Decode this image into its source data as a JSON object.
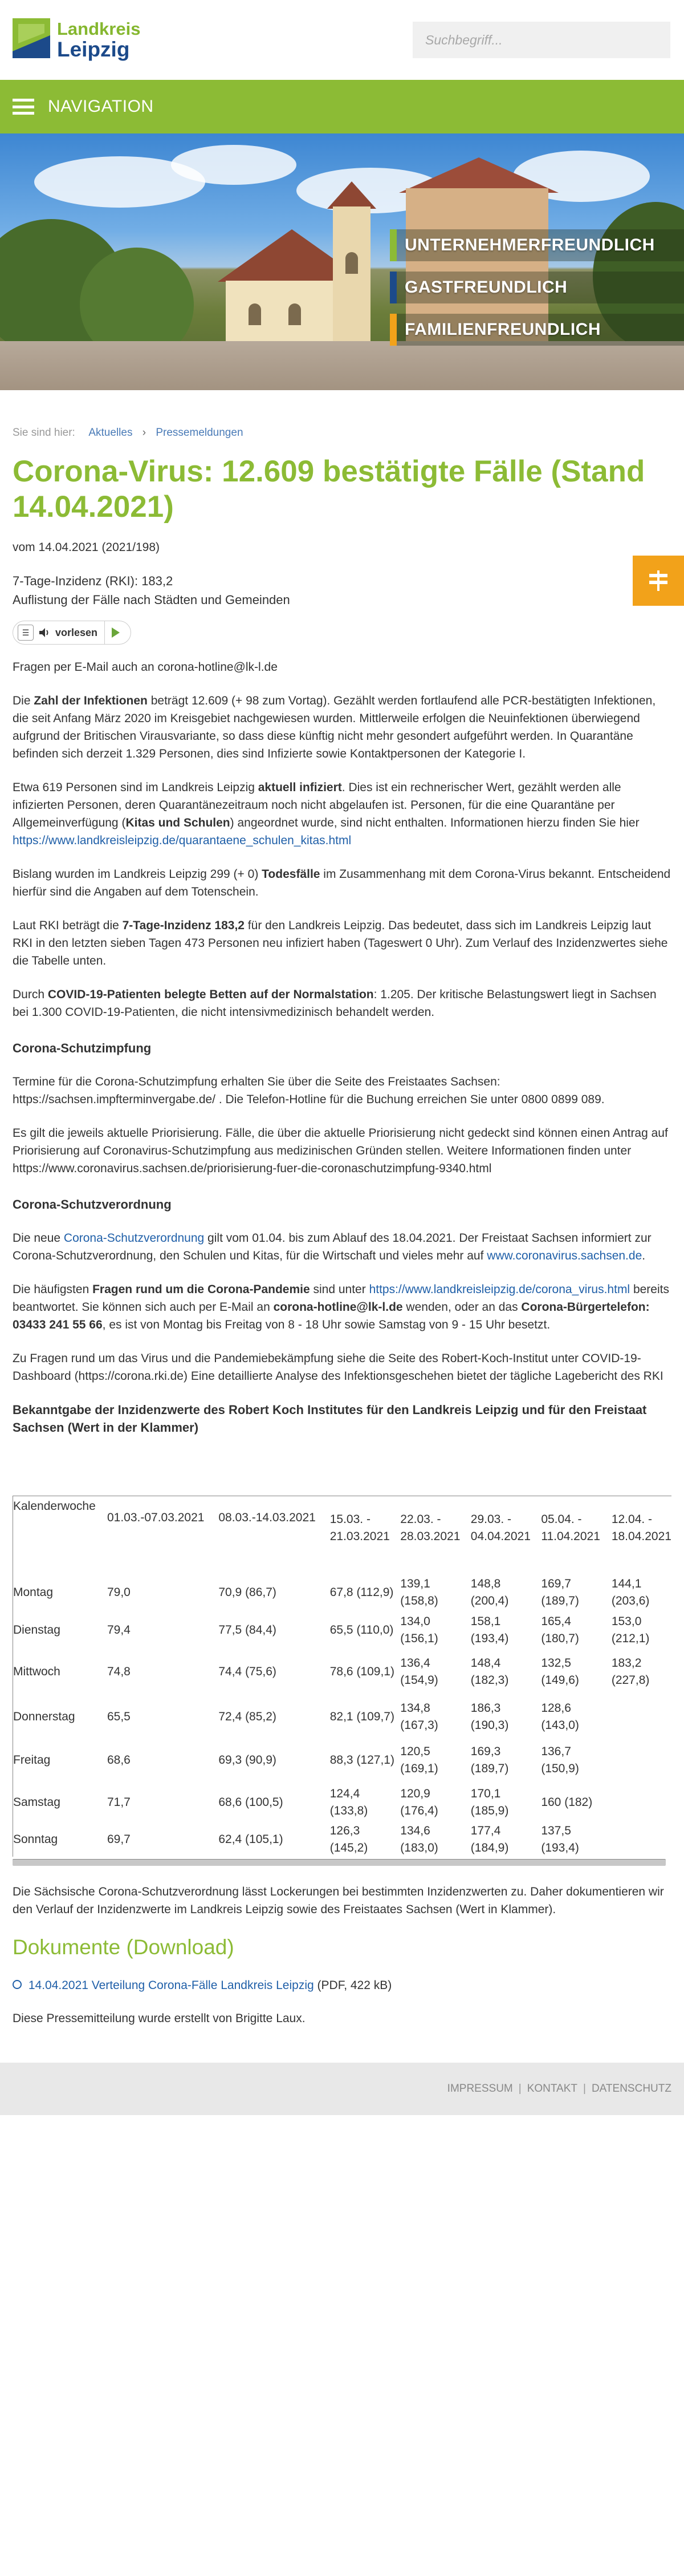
{
  "header": {
    "logo_line1": "Landkreis",
    "logo_line2": "Leipzig",
    "search_placeholder": "Suchbegriff..."
  },
  "nav": {
    "label": "NAVIGATION"
  },
  "hero": {
    "slogans": [
      {
        "text": "UNTERNEHMERFREUNDLICH",
        "color": "#8cbb35"
      },
      {
        "text": "GASTFREUNDLICH",
        "color": "#1c4a8a"
      },
      {
        "text": "FAMILIENFREUNDLICH",
        "color": "#f2a21a"
      }
    ]
  },
  "breadcrumb": {
    "prefix": "Sie sind hier:",
    "items": [
      "Aktuelles",
      "Pressemeldungen"
    ]
  },
  "article": {
    "title": "Corona-Virus: 12.609 bestätigte Fälle (Stand 14.04.2021)",
    "date": "vom 14.04.2021 (2021/198)",
    "lead1": "7-Tage-Inzidenz (RKI): 183,2",
    "lead2": "Auflistung der Fälle nach Städten und Gemeinden",
    "reader_label": "vorlesen",
    "email_line": "Fragen per E-Mail auch an corona-hotline@lk-l.de",
    "p1a": "Die ",
    "p1b": "Zahl der Infektionen",
    "p1c": " beträgt 12.609 (+ 98 zum Vortag). Gezählt werden fortlaufend alle PCR-bestätigten Infektionen, die seit Anfang März 2020 im Kreisgebiet nachgewiesen wurden. Mittlerweile erfolgen die Neuinfektionen überwiegend aufgrund der Britischen Virausvariante, so dass diese künftig nicht mehr gesondert aufgeführt werden. In Quarantäne befinden sich derzeit 1.329 Personen, dies sind Infizierte sowie Kontaktpersonen der Kategorie I.",
    "p2a": "Etwa 619 Personen sind im Landkreis Leipzig ",
    "p2b": "aktuell infiziert",
    "p2c": ". Dies ist ein rechnerischer Wert, gezählt werden alle infizierten Personen, deren Quarantänezeitraum noch nicht abgelaufen ist. Personen, für die eine Quarantäne per Allgemeinverfügung (",
    "p2d": "Kitas und Schulen",
    "p2e": ") angeordnet wurde, sind nicht enthalten. Informationen hierzu finden Sie hier ",
    "p2link": "https://www.landkreisleipzig.de/quarantaene_schulen_kitas.html",
    "p3a": "Bislang wurden im Landkreis Leipzig 299 (+ 0) ",
    "p3b": "Todesfälle",
    "p3c": " im Zusammenhang mit dem Corona-Virus bekannt. Entscheidend hierfür sind die Angaben auf dem Totenschein.",
    "p4a": "Laut RKI beträgt die ",
    "p4b": "7-Tage-Inzidenz 183,2",
    "p4c": " für den Landkreis Leipzig. Das bedeutet, dass sich im Landkreis Leipzig laut RKI in den letzten sieben Tagen 473 Personen neu infiziert haben (Tageswert 0 Uhr). Zum Verlauf des Inzidenzwertes siehe die Tabelle unten.",
    "p5a": "Durch ",
    "p5b": "COVID-19-Patienten belegte Betten auf der Normalstation",
    "p5c": ": 1.205. Der kritische Belastungswert liegt in Sachsen bei 1.300 COVID-19-Patienten, die nicht intensivmedizinisch behandelt werden.",
    "h_impf": "Corona-Schutzimpfung",
    "p6": "Termine für die Corona-Schutzimpfung erhalten Sie über die Seite des Freistaates Sachsen: https://sachsen.impfterminvergabe.de/ . Die Telefon-Hotline für die Buchung erreichen Sie unter 0800 0899 089.",
    "p7": "Es gilt die jeweils aktuelle Priorisierung. Fälle, die über die aktuelle Priorisierung nicht gedeckt sind können einen Antrag auf Priorisierung auf Coronavirus-Schutzimpfung aus medizinischen Gründen stellen. Weitere Informationen finden unter https://www.coronavirus.sachsen.de/priorisierung-fuer-die-coronaschutzimpfung-9340.html",
    "h_vo": "Corona-Schutzverordnung",
    "p8a": "Die neue ",
    "p8link": "Corona-Schutzverordnung",
    "p8b": " gilt vom 01.04. bis zum Ablauf des 18.04.2021. Der Freistaat Sachsen informiert zur Corona-Schutzverordnung, den Schulen und Kitas, für die Wirtschaft und vieles mehr auf ",
    "p8link2": "www.coronavirus.sachsen.de",
    "p8c": ".",
    "p9a": "Die häufigsten ",
    "p9b": "Fragen rund um die Corona-Pandemie",
    "p9c": " sind unter ",
    "p9link": "https://www.landkreisleipzig.de/corona_virus.html",
    "p9d": " bereits beantwortet. Sie können sich auch per E-Mail an ",
    "p9e": "corona-hotline@lk-l.de",
    "p9f": " wenden, oder an das ",
    "p9g": "Corona-Bürgertelefon: 03433 241 55 66",
    "p9h": ", es ist von Montag bis Freitag von 8 - 18 Uhr sowie Samstag von 9 - 15 Uhr besetzt.",
    "p10": "Zu Fragen rund um das Virus und die Pandemiebekämpfung siehe die Seite des Robert-Koch-Institut unter COVID-19-Dashboard (https://corona.rki.de)  Eine detaillierte Analyse des Infektionsgeschehen bietet der tägliche Lagebericht des RKI",
    "h_table": "Bekanntgabe der Inzidenzwerte des Robert Koch Institutes für den Landkreis Leipzig und für den Freistaat Sachsen (Wert in der Klammer)",
    "after_table": "Die Sächsische Corona-Schutzverordnung lässt Lockerungen bei bestimmten Inzidenzwerten zu. Daher dokumentieren wir den Verlauf der Inzidenzwerte im Landkreis Leipzig sowie des Freistaates Sachsen (Wert in Klammer).",
    "docs_heading": "Dokumente (Download)",
    "doc_link": "14.04.2021 Verteilung Corona-Fälle Landkreis Leipzig",
    "doc_meta": " (PDF, 422 kB)",
    "author": "Diese Pressemitteilung wurde erstellt von Brigitte Laux."
  },
  "table": {
    "headers": [
      "Kalenderwoche",
      "01.03.-07.03.2021",
      "08.03.-14.03.2021",
      "15.03. - 21.03.2021",
      "22.03. - 28.03.2021",
      "29.03. - 04.04.2021",
      "05.04. - 11.04.2021",
      "12.04. - 18.04.2021"
    ],
    "rows": [
      [
        "Montag",
        "79,0",
        "70,9 (86,7)",
        "67,8 (112,9)",
        "139,1 (158,8)",
        "148,8 (200,4)",
        "169,7 (189,7)",
        "144,1 (203,6)"
      ],
      [
        "Dienstag",
        "79,4",
        "77,5 (84,4)",
        "65,5 (110,0)",
        "134,0 (156,1)",
        "158,1 (193,4)",
        "165,4 (180,7)",
        "153,0 (212,1)"
      ],
      [
        "Mittwoch",
        "74,8",
        "74,4 (75,6)",
        "78,6 (109,1)",
        "136,4 (154,9)",
        "148,4 (182,3)",
        "132,5 (149,6)",
        "183,2 (227,8)"
      ],
      [
        "Donnerstag",
        "65,5",
        "72,4 (85,2)",
        "82,1 (109,7)",
        "134,8 (167,3)",
        "186,3 (190,3)",
        "128,6 (143,0)",
        ""
      ],
      [
        "Freitag",
        "68,6",
        "69,3 (90,9)",
        "88,3 (127,1)",
        "120,5 (169,1)",
        "169,3 (189,7)",
        "136,7 (150,9)",
        ""
      ],
      [
        "Samstag",
        "71,7",
        "68,6 (100,5)",
        "124,4 (133,8)",
        "120,9 (176,4)",
        "170,1 (185,9)",
        "160 (182)",
        ""
      ],
      [
        "Sonntag",
        "69,7",
        "62,4 (105,1)",
        "126,3 (145,2)",
        "134,6 (183,0)",
        "177,4 (184,9)",
        "137,5 (193,4)",
        ""
      ]
    ]
  },
  "footer": {
    "links": [
      "IMPRESSUM",
      "KONTAKT",
      "DATENSCHUTZ"
    ]
  }
}
